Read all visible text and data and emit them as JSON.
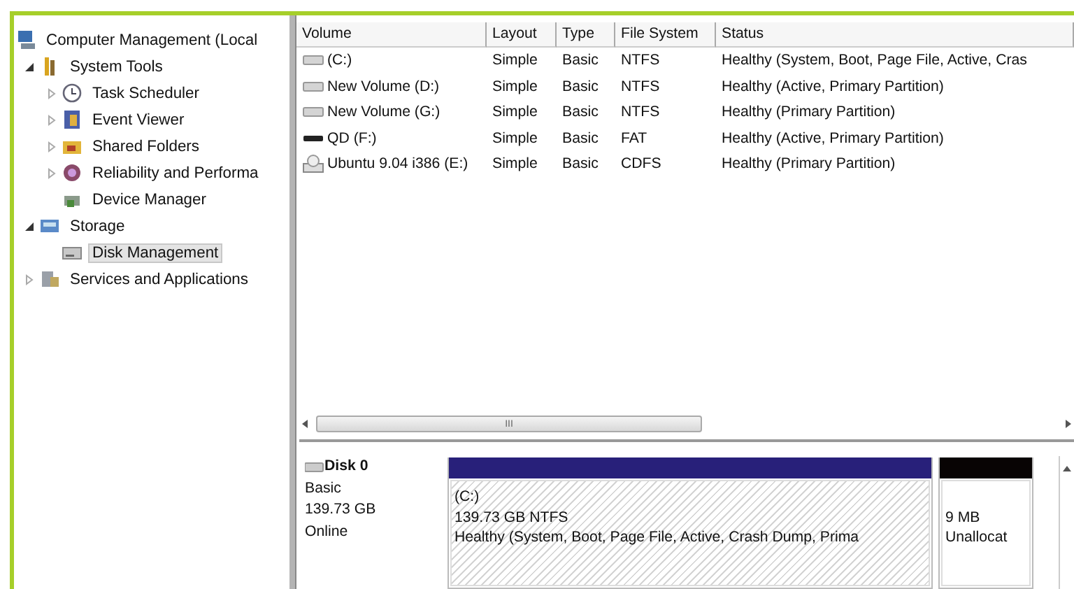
{
  "tree": [
    {
      "label": "Computer Management (Local",
      "selected": false,
      "children": [
        {
          "label": "System Tools",
          "selected": false,
          "expanded": true,
          "children": [
            {
              "label": "Task Scheduler",
              "selected": false,
              "expanded": false
            },
            {
              "label": "Event Viewer",
              "selected": false,
              "expanded": false
            },
            {
              "label": "Shared Folders",
              "selected": false,
              "expanded": false
            },
            {
              "label": "Reliability and Performa",
              "selected": false,
              "expanded": false
            },
            {
              "label": "Device Manager",
              "selected": false
            }
          ]
        },
        {
          "label": "Storage",
          "selected": false,
          "expanded": true,
          "children": [
            {
              "label": "Disk Management",
              "selected": true
            }
          ]
        },
        {
          "label": "Services and Applications",
          "selected": false,
          "expanded": false
        }
      ]
    }
  ],
  "table": {
    "columns": [
      "Volume",
      "Layout",
      "Type",
      "File System",
      "Status"
    ],
    "rows": [
      {
        "kind": "disk",
        "cells": [
          "(C:)",
          "Simple",
          "Basic",
          "NTFS",
          "Healthy (System, Boot, Page File, Active, Cras"
        ]
      },
      {
        "kind": "disk",
        "cells": [
          "New Volume (D:)",
          "Simple",
          "Basic",
          "NTFS",
          "Healthy (Active, Primary Partition)"
        ]
      },
      {
        "kind": "disk",
        "cells": [
          "New Volume (G:)",
          "Simple",
          "Basic",
          "NTFS",
          "Healthy (Primary Partition)"
        ]
      },
      {
        "kind": "removable",
        "cells": [
          "QD (F:)",
          "Simple",
          "Basic",
          "FAT",
          "Healthy (Active, Primary Partition)"
        ]
      },
      {
        "kind": "cd",
        "cells": [
          "Ubuntu 9.04 i386 (E:)",
          "Simple",
          "Basic",
          "CDFS",
          "Healthy (Primary Partition)"
        ]
      }
    ]
  },
  "scrollbar_grip": "III",
  "disk": {
    "name": "Disk 0",
    "details": [
      "Basic",
      "139.73 GB",
      "Online"
    ],
    "partitions": [
      {
        "color": "#28207a",
        "selected": true,
        "lines": [
          "(C:)",
          "139.73 GB NTFS",
          "Healthy (System, Boot, Page File, Active, Crash Dump, Prima"
        ]
      },
      {
        "color": "#080404",
        "selected": false,
        "lines": [
          "9 MB",
          "Unallocat"
        ]
      }
    ]
  }
}
